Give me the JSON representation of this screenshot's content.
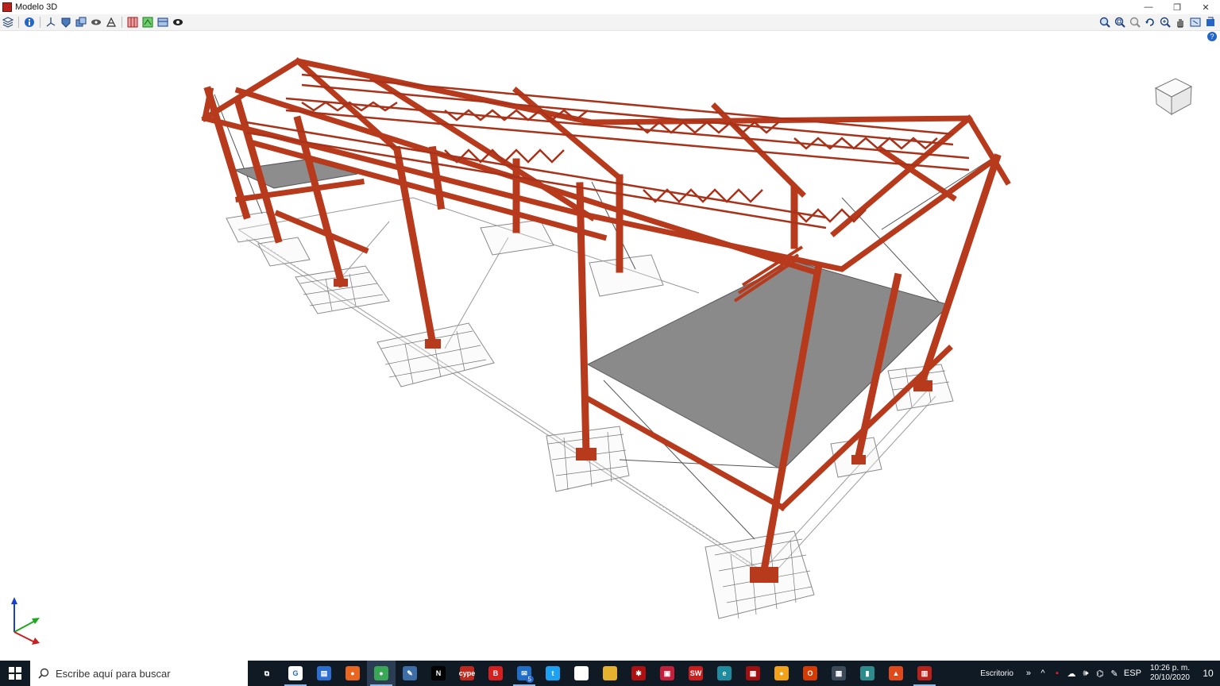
{
  "window": {
    "title": "Modelo 3D",
    "minimize": "—",
    "restore": "❐",
    "close": "✕"
  },
  "toolbar": {
    "left_icons": [
      "layers-icon",
      "info-icon",
      "axes-icon",
      "shield-icon",
      "copy-view-icon",
      "eye-hide-icon",
      "structure-icon",
      "grid-icon",
      "colors-icon",
      "panel-icon",
      "eye-icon"
    ],
    "right_icons": [
      "zoom-all-icon",
      "zoom-window-icon",
      "zoom-prev-icon",
      "rotate-icon",
      "zoom-icon",
      "pan-icon",
      "view-window-icon",
      "export-icon"
    ]
  },
  "help": "?",
  "taskbar": {
    "search_placeholder": "Escribe aquí para buscar",
    "apps": [
      {
        "name": "task-view-icon",
        "color": "#101a24",
        "label": "⧉"
      },
      {
        "name": "google-icon",
        "color": "#ffffff",
        "label": "G"
      },
      {
        "name": "store-icon",
        "color": "#2d6fd1",
        "label": "▤"
      },
      {
        "name": "firefox-icon",
        "color": "#e8661e",
        "label": "●"
      },
      {
        "name": "chrome-icon",
        "color": "#3aa757",
        "label": "●"
      },
      {
        "name": "tool-icon",
        "color": "#3e6ea8",
        "label": "✎"
      },
      {
        "name": "netflix-icon",
        "color": "#000000",
        "label": "N"
      },
      {
        "name": "cype-icon",
        "color": "#c0291d",
        "label": "cype"
      },
      {
        "name": "b-app-icon",
        "color": "#d62020",
        "label": "B"
      },
      {
        "name": "mail-icon",
        "color": "#1f6fc8",
        "label": "✉"
      },
      {
        "name": "twitter-icon",
        "color": "#1da1f2",
        "label": "t"
      },
      {
        "name": "file-icon",
        "color": "#ffffff",
        "label": ""
      },
      {
        "name": "folder-icon",
        "color": "#e5b22e",
        "label": ""
      },
      {
        "name": "red-app-icon",
        "color": "#b01010",
        "label": "✱"
      },
      {
        "name": "gift-icon",
        "color": "#c41f3b",
        "label": "▣"
      },
      {
        "name": "solidworks-icon",
        "color": "#cc1d1d",
        "label": "SW"
      },
      {
        "name": "edge-icon",
        "color": "#1e8c9e",
        "label": "e"
      },
      {
        "name": "cad-icon",
        "color": "#a01010",
        "label": "▦"
      },
      {
        "name": "chat-icon",
        "color": "#f2a21a",
        "label": "●"
      },
      {
        "name": "office-icon",
        "color": "#d83b01",
        "label": "O"
      },
      {
        "name": "calculator-icon",
        "color": "#3c4a5a",
        "label": "▦"
      },
      {
        "name": "chart-app-icon",
        "color": "#2e8b8b",
        "label": "▮"
      },
      {
        "name": "pdf-icon",
        "color": "#e04a1a",
        "label": "▲"
      },
      {
        "name": "cypecad-icon",
        "color": "#b8221a",
        "label": "▥"
      }
    ],
    "mail_badge": "5",
    "desktop_label": "Escritorio",
    "desktop_chevron": "»",
    "tray_icons": [
      "^",
      "▪",
      "☁",
      "🕪",
      "⌬",
      "✎"
    ],
    "language": "ESP",
    "time": "10:26 p. m.",
    "date": "20/10/2020",
    "notification_count": "10"
  }
}
